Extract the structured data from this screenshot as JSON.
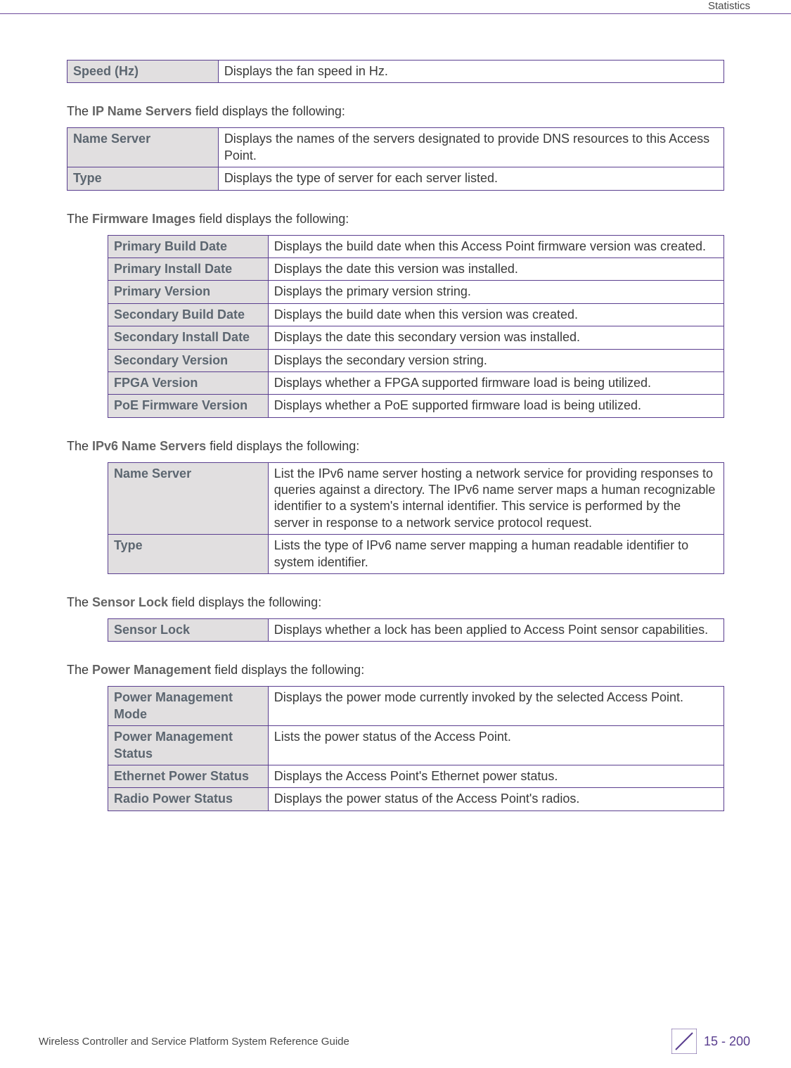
{
  "header": {
    "section": "Statistics"
  },
  "tables": {
    "speed": {
      "rows": [
        {
          "label": "Speed (Hz)",
          "desc": "Displays the fan speed in Hz."
        }
      ]
    },
    "ip_name_servers_intro": {
      "prefix": "The ",
      "term": "IP Name Servers",
      "suffix": " field displays the following:"
    },
    "ip_name_servers": {
      "rows": [
        {
          "label": "Name Server",
          "desc": "Displays the names of the servers designated to provide DNS resources to this Access Point."
        },
        {
          "label": "Type",
          "desc": "Displays the type of server for each server listed."
        }
      ]
    },
    "firmware_images_intro": {
      "prefix": "The ",
      "term": "Firmware Images",
      "suffix": " field displays the following:"
    },
    "firmware_images": {
      "rows": [
        {
          "label": "Primary Build Date",
          "desc": "Displays the build date when this Access Point firmware version was created."
        },
        {
          "label": "Primary Install Date",
          "desc": "Displays the date this version was installed."
        },
        {
          "label": "Primary Version",
          "desc": "Displays the primary version string."
        },
        {
          "label": "Secondary Build Date",
          "desc": "Displays the build date when this version was created."
        },
        {
          "label": "Secondary Install Date",
          "desc": "Displays the date this secondary version was installed."
        },
        {
          "label": "Secondary Version",
          "desc": "Displays the secondary version string."
        },
        {
          "label": "FPGA Version",
          "desc": "Displays whether a FPGA supported firmware load is being utilized."
        },
        {
          "label": "PoE Firmware Version",
          "desc": "Displays whether a PoE supported firmware load is being utilized."
        }
      ]
    },
    "ipv6_name_servers_intro": {
      "prefix": "The ",
      "term": "IPv6 Name Servers",
      "suffix": " field displays the following:"
    },
    "ipv6_name_servers": {
      "rows": [
        {
          "label": "Name Server",
          "desc": "List the IPv6 name server hosting a network service for providing responses to queries against a directory. The IPv6 name server maps a human recognizable identifier to a system's internal identifier. This service is performed by the server in response to a network service protocol request."
        },
        {
          "label": "Type",
          "desc": "Lists the type of IPv6 name server mapping a human readable identifier to system identifier."
        }
      ]
    },
    "sensor_lock_intro": {
      "prefix": "The ",
      "term": "Sensor Lock",
      "suffix": " field displays the following:"
    },
    "sensor_lock": {
      "rows": [
        {
          "label": "Sensor Lock",
          "desc": "Displays whether a lock has been applied to Access Point sensor capabilities."
        }
      ]
    },
    "power_management_intro": {
      "prefix": "The ",
      "term": "Power Management",
      "suffix": " field displays the following:"
    },
    "power_management": {
      "rows": [
        {
          "label": "Power Management Mode",
          "desc": "Displays the power mode currently invoked by the selected Access Point."
        },
        {
          "label": "Power Management Status",
          "desc": "Lists the power status of the Access Point."
        },
        {
          "label": "Ethernet Power Status",
          "desc": "Displays the Access Point's Ethernet power status."
        },
        {
          "label": "Radio Power Status",
          "desc": "Displays the power status of the Access Point's radios."
        }
      ]
    }
  },
  "footer": {
    "guide_title": "Wireless Controller and Service Platform System Reference Guide",
    "page": "15 - 200"
  }
}
